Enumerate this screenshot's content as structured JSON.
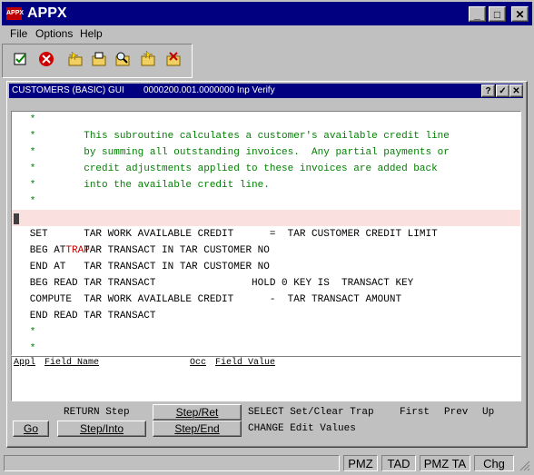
{
  "app": {
    "title": "APPX",
    "icon_text": "APPX"
  },
  "window_controls": {
    "minimize": "_",
    "maximize": "□",
    "close": "✕"
  },
  "menu": {
    "items": [
      "File",
      "Options",
      "Help"
    ]
  },
  "toolbar": {
    "icons": [
      "check-doc-icon",
      "cancel-icon",
      "new-icon",
      "folder-open-icon",
      "folder-search-icon",
      "folder-star-icon",
      "folder-cancel-icon"
    ]
  },
  "inner_window": {
    "title": "CUSTOMERS (BASIC) GUI",
    "subtitle": "0000200.001.0000000 Inp Verify",
    "controls": {
      "help": "?",
      "ok": "✓",
      "close": "✕"
    }
  },
  "code_lines": [
    {
      "text": "   *",
      "color": "#008000"
    },
    {
      "text": "   *        This subroutine calculates a customer's available credit line",
      "color": "#008000"
    },
    {
      "text": "   *        by summing all outstanding invoices.  Any partial payments or",
      "color": "#008000"
    },
    {
      "text": "   *        credit adjustments applied to these invoices are added back",
      "color": "#008000"
    },
    {
      "text": "   *        into the available credit line.",
      "color": "#008000"
    },
    {
      "text": "   *",
      "color": "#008000"
    },
    {
      "text": "   TRAP",
      "color": "#c00000"
    },
    {
      "text": "   SET      TAR WORK AVAILABLE CREDIT      =  TAR CUSTOMER CREDIT LIMIT",
      "color": "#000000"
    },
    {
      "text": "   BEG AT   TAR TRANSACT IN TAR CUSTOMER NO",
      "color": "#000000"
    },
    {
      "text": "   END AT   TAR TRANSACT IN TAR CUSTOMER NO",
      "color": "#000000"
    },
    {
      "text": "   BEG READ TAR TRANSACT                HOLD 0 KEY IS  TRANSACT KEY",
      "color": "#000000"
    },
    {
      "text": "   COMPUTE  TAR WORK AVAILABLE CREDIT      -  TAR TRANSACT AMOUNT",
      "color": "#000000"
    },
    {
      "text": "   END READ TAR TRANSACT",
      "color": "#000000"
    },
    {
      "text": "   *",
      "color": "#008000"
    },
    {
      "text": "   *",
      "color": "#008000"
    }
  ],
  "field_header": {
    "appl": "Appl",
    "field_name": "Field Name",
    "occ": "Occ",
    "field_value": "Field Value"
  },
  "buttons": {
    "return_step": "RETURN Step",
    "step_ret": "Step/Ret",
    "go": "Go",
    "step_into": "Step/Into",
    "step_end": "Step/End"
  },
  "hints": {
    "select": "SELECT Set/Clear Trap",
    "change": "CHANGE Edit Values",
    "first": "First",
    "prev": "Prev",
    "up": "Up"
  },
  "status": {
    "panes": [
      "PMZ",
      "TAD",
      "PMZ TA",
      "Chg"
    ]
  }
}
